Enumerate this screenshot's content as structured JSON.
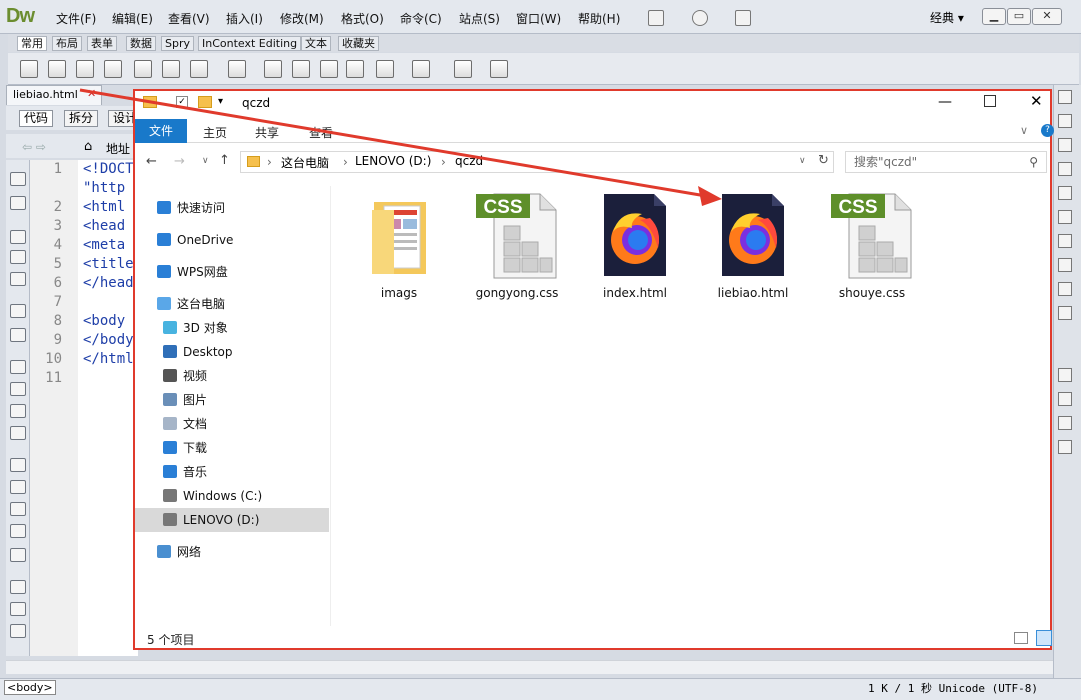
{
  "dw": {
    "logo": "Dw",
    "menu": [
      "文件(F)",
      "编辑(E)",
      "查看(V)",
      "插入(I)",
      "修改(M)",
      "格式(O)",
      "命令(C)",
      "站点(S)",
      "窗口(W)",
      "帮助(H)"
    ],
    "workspace": "经典",
    "insert_tabs": [
      "常用",
      "布局",
      "表单",
      "数据",
      "Spry",
      "InContext Editing",
      "文本",
      "收藏夹"
    ],
    "doc_tab": "liebiao.html",
    "view_buttons": [
      "代码",
      "拆分",
      "设计"
    ],
    "address_label": "地址",
    "line_numbers": [
      "1",
      "",
      "2",
      "3",
      "4",
      "5",
      "6",
      "7",
      "8",
      "9",
      "10",
      "11"
    ],
    "code_lines": [
      "<!DOCTYPE",
      "\"http",
      "<html",
      "<head",
      "<meta",
      "<title",
      "</head",
      "",
      "<body",
      "</body",
      "</html",
      ""
    ],
    "status_tag": "<body>",
    "status_info": "1 K / 1 秒  Unicode (UTF-8)"
  },
  "explorer": {
    "title": "qczd",
    "ribbon_tabs": [
      "文件",
      "主页",
      "共享",
      "查看"
    ],
    "breadcrumb": [
      "这台电脑",
      "LENOVO (D:)",
      "qczd"
    ],
    "search_placeholder": "搜索\"qczd\"",
    "sidebar": [
      {
        "label": "快速访问",
        "icon": "star-icon",
        "level": 0
      },
      {
        "label": "OneDrive",
        "icon": "cloud-icon",
        "level": 0
      },
      {
        "label": "WPS网盘",
        "icon": "cloud-icon",
        "level": 0
      },
      {
        "label": "这台电脑",
        "icon": "computer-icon",
        "level": 0
      },
      {
        "label": "3D 对象",
        "icon": "cube-icon",
        "level": 1
      },
      {
        "label": "Desktop",
        "icon": "desktop-icon",
        "level": 1
      },
      {
        "label": "视频",
        "icon": "video-icon",
        "level": 1
      },
      {
        "label": "图片",
        "icon": "picture-icon",
        "level": 1
      },
      {
        "label": "文档",
        "icon": "document-icon",
        "level": 1
      },
      {
        "label": "下载",
        "icon": "download-icon",
        "level": 1
      },
      {
        "label": "音乐",
        "icon": "music-icon",
        "level": 1
      },
      {
        "label": "Windows (C:)",
        "icon": "drive-icon",
        "level": 1
      },
      {
        "label": "LENOVO (D:)",
        "icon": "drive-icon",
        "level": 1,
        "selected": true
      },
      {
        "label": "网络",
        "icon": "network-icon",
        "level": 0
      }
    ],
    "files": [
      {
        "name": "imags",
        "type": "folder"
      },
      {
        "name": "gongyong.css",
        "type": "css"
      },
      {
        "name": "index.html",
        "type": "firefox"
      },
      {
        "name": "liebiao.html",
        "type": "firefox"
      },
      {
        "name": "shouye.css",
        "type": "css"
      }
    ],
    "css_badge": "CSS",
    "item_count": "5 个项目",
    "annotation_color": "#e03a2c"
  }
}
